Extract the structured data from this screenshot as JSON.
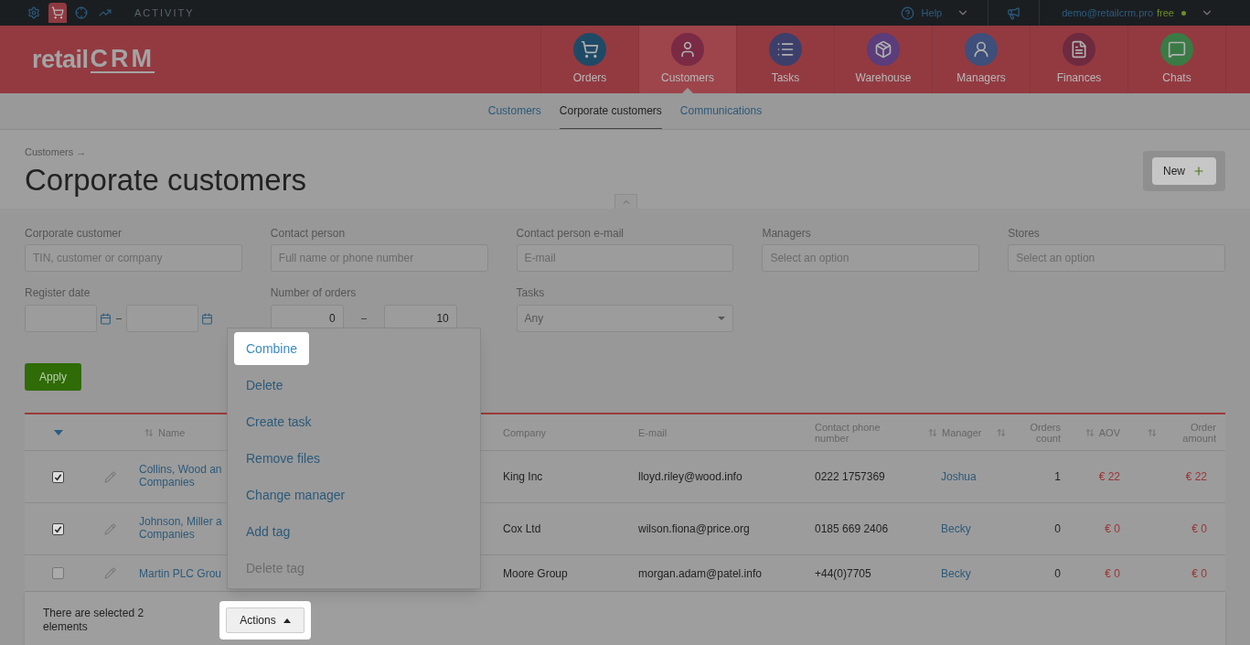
{
  "top_bar": {
    "icons": [
      {
        "kind": "settings",
        "selected": false
      },
      {
        "kind": "cart",
        "selected": true
      },
      {
        "kind": "target",
        "selected": false
      },
      {
        "kind": "chart",
        "selected": false
      }
    ],
    "activity_label": "ACTIVITY",
    "help": "Help",
    "account": "demo@retailcrm.pro",
    "plan": "free"
  },
  "logo": {
    "prefix": "retail",
    "mark": "CRM"
  },
  "nav": [
    {
      "label": "Orders",
      "kind": "orders",
      "selected": false
    },
    {
      "label": "Customers",
      "kind": "customers",
      "selected": true
    },
    {
      "label": "Tasks",
      "kind": "tasks",
      "selected": false
    },
    {
      "label": "Warehouse",
      "kind": "warehouse",
      "selected": false
    },
    {
      "label": "Managers",
      "kind": "managers",
      "selected": false
    },
    {
      "label": "Finances",
      "kind": "finances",
      "selected": false
    },
    {
      "label": "Chats",
      "kind": "chats",
      "selected": false
    }
  ],
  "subnav": [
    {
      "label": "Customers",
      "selected": false
    },
    {
      "label": "Corporate customers",
      "selected": true
    },
    {
      "label": "Communications",
      "selected": false
    }
  ],
  "breadcrumb": "Customers →",
  "title": "Corporate customers",
  "new_button": "New",
  "filters": [
    {
      "label": "Corporate customer",
      "placeholder": "TIN, customer or company"
    },
    {
      "label": "Contact person",
      "placeholder": "Full name or phone number"
    },
    {
      "label": "Contact person e-mail",
      "placeholder": "E-mail"
    },
    {
      "label": "Managers",
      "placeholder": "Select an option"
    },
    {
      "label": "Stores",
      "placeholder": "Select an option"
    }
  ],
  "register_date": {
    "label": "Register date"
  },
  "number_of_orders": {
    "label": "Number of orders",
    "from": "0",
    "to": "10"
  },
  "tasks": {
    "label": "Tasks",
    "value": "Any"
  },
  "apply_button": "Apply",
  "table": {
    "columns": [
      {
        "kind": "toggle"
      },
      {
        "kind": "edit"
      },
      {
        "kind": "text",
        "label": "Name",
        "sortable": true
      },
      {
        "kind": "text",
        "label": "Company",
        "sortable": false
      },
      {
        "kind": "text",
        "label": "E-mail",
        "sortable": false
      },
      {
        "kind": "text",
        "label": "Contact phone number",
        "sortable": false
      },
      {
        "kind": "text",
        "label": "Manager",
        "sortable": true
      },
      {
        "kind": "number",
        "label": "Orders count",
        "sortable": true
      },
      {
        "kind": "number",
        "label": "AOV",
        "sortable": true
      },
      {
        "kind": "number",
        "label": "Order amount",
        "sortable": true
      }
    ],
    "rows": [
      {
        "checked": true,
        "name_lines": [
          "Collins, Wood an",
          "Companies"
        ],
        "company": "King Inc",
        "email": "lloyd.riley@wood.info",
        "phone": "0222 1757369",
        "manager": "Joshua",
        "orders_count": "1",
        "aov": "€ 22",
        "order_amount": "€ 22"
      },
      {
        "checked": true,
        "name_lines": [
          "Johnson, Miller a",
          "Companies"
        ],
        "company": "Cox Ltd",
        "email": "wilson.fiona@price.org",
        "phone": "0185 669 2406",
        "manager": "Becky",
        "orders_count": "0",
        "aov": "€ 0",
        "order_amount": "€ 0"
      },
      {
        "checked": false,
        "name_lines": [
          "Martin PLC Grou"
        ],
        "company": "Moore Group",
        "email": "morgan.adam@patel.info",
        "phone": "+44(0)7705",
        "manager": "Becky",
        "orders_count": "0",
        "aov": "€ 0",
        "order_amount": "€ 0"
      }
    ]
  },
  "selection_bar": {
    "text": "There are selected 2 elements"
  },
  "actions_button": {
    "label": "Actions",
    "highlighted": true
  },
  "actions_menu": [
    {
      "label": "Combine",
      "highlighted": true,
      "disabled": false
    },
    {
      "label": "Delete",
      "highlighted": false,
      "disabled": false
    },
    {
      "label": "Create task",
      "highlighted": false,
      "disabled": false
    },
    {
      "label": "Remove files",
      "highlighted": false,
      "disabled": false
    },
    {
      "label": "Change manager",
      "highlighted": false,
      "disabled": false
    },
    {
      "label": "Add tag",
      "highlighted": false,
      "disabled": false
    },
    {
      "label": "Delete tag",
      "highlighted": false,
      "disabled": true
    }
  ]
}
